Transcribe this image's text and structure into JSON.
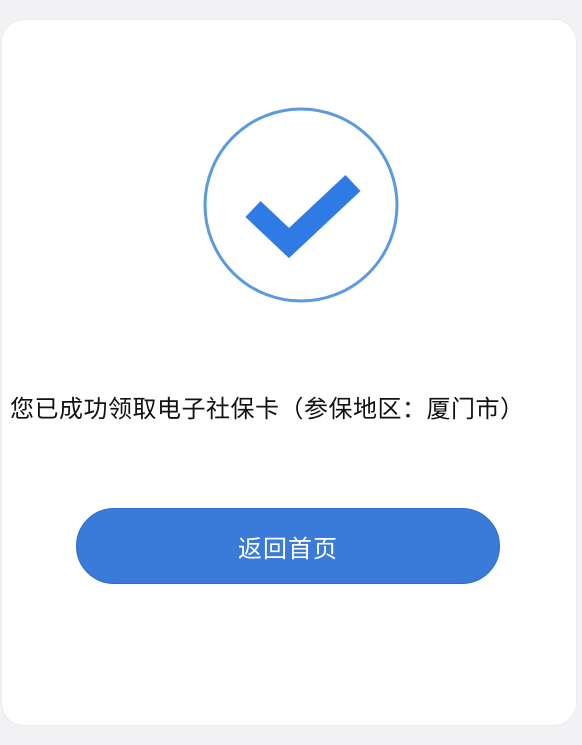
{
  "status_icon": "check-circle-icon",
  "colors": {
    "accent": "#3a7ad9",
    "check": "#2f7be6",
    "circle_stroke": "#5b9ae0"
  },
  "message": "您已成功领取电子社保卡（参保地区：厦门市）",
  "home_button_label": "返回首页"
}
